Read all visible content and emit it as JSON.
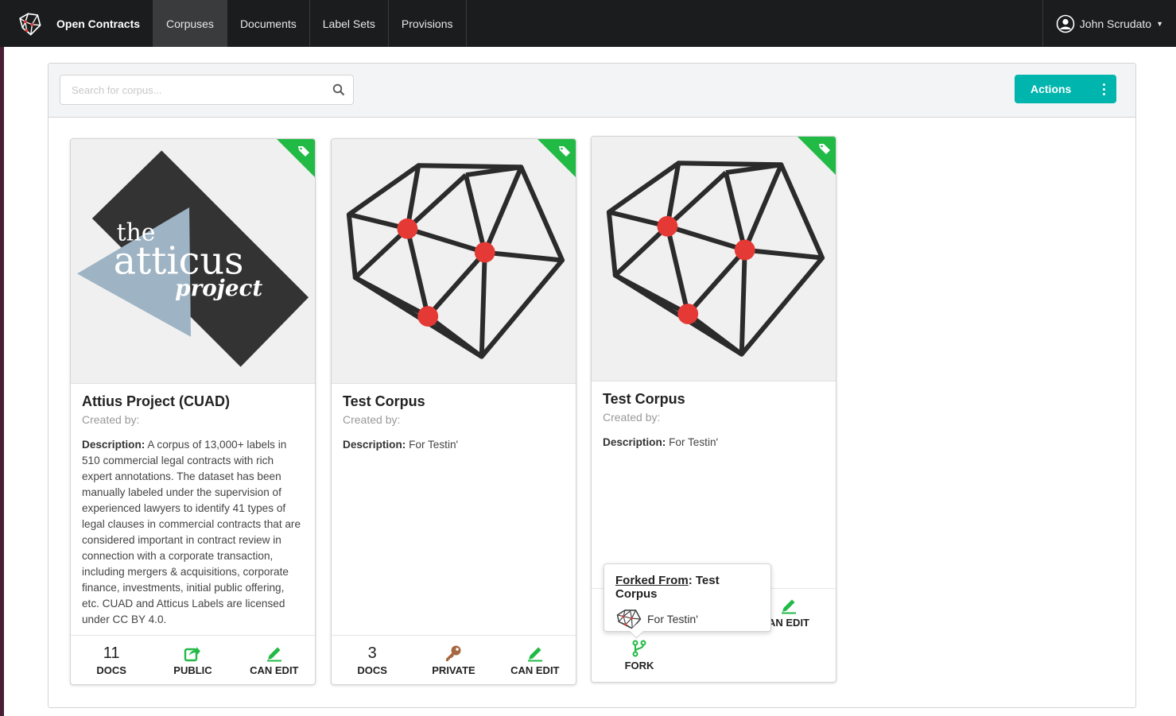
{
  "nav": {
    "brand": "Open Contracts",
    "items": [
      {
        "label": "Corpuses",
        "active": true
      },
      {
        "label": "Documents",
        "active": false
      },
      {
        "label": "Label Sets",
        "active": false
      },
      {
        "label": "Provisions",
        "active": false
      }
    ],
    "user": "John Scrudato"
  },
  "toolbar": {
    "search_placeholder": "Search for corpus...",
    "actions_label": "Actions"
  },
  "colors": {
    "accent": "#00b5ad",
    "tag": "#21ba45",
    "edit": "#21ba45",
    "private": "#a5673f",
    "fork": "#21ba45"
  },
  "cards": [
    {
      "title": "Attius Project (CUAD)",
      "created_by": "Created by:",
      "description_label": "Description:",
      "description": "A corpus of 13,000+ labels in 510 commercial legal contracts with rich expert annotations. The dataset has been manually labeled under the supervision of experienced lawyers to identify 41 types of legal clauses in commercial contracts that are considered important in contract review in connection with a corporate transaction, including mergers & acquisitions, corporate finance, investments, initial public offering, etc. CUAD and Atticus Labels are licensed under CC BY 4.0.",
      "logo_text": [
        "the",
        "atticus",
        "project"
      ],
      "docs_count": "11",
      "docs_label": "DOCS",
      "visibility_label": "PUBLIC",
      "edit_label": "CAN EDIT"
    },
    {
      "title": "Test Corpus",
      "created_by": "Created by:",
      "description_label": "Description:",
      "description": "For Testin'",
      "docs_count": "3",
      "docs_label": "DOCS",
      "visibility_label": "PRIVATE",
      "edit_label": "CAN EDIT"
    },
    {
      "title": "Test Corpus",
      "created_by": "Created by:",
      "description_label": "Description:",
      "description": "For Testin'",
      "edit_label": "AN EDIT",
      "fork_label": "FORK"
    }
  ],
  "popup": {
    "forked_label": "Forked From",
    "forked_name": ": Test Corpus",
    "description": "For Testin'"
  }
}
